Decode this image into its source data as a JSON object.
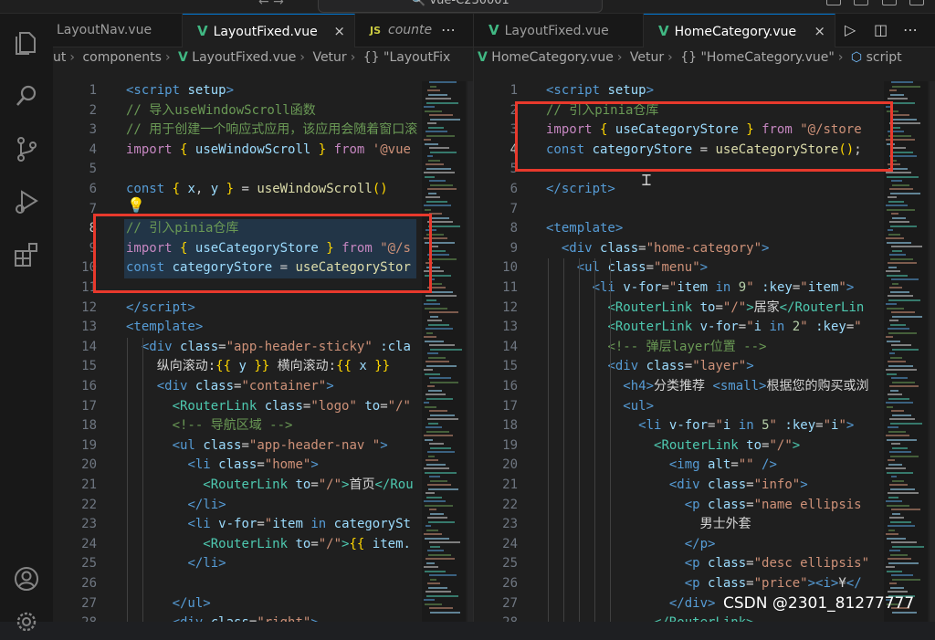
{
  "titlebar": {
    "nav_arrows": "← →",
    "command_center": "🔍 vue-C230001"
  },
  "activity_bar": {
    "icons": [
      "files-icon",
      "search-icon",
      "source-control-icon",
      "run-debug-icon",
      "extensions-icon",
      "account-icon",
      "settings-gear-icon"
    ]
  },
  "left_editor": {
    "tabs": [
      {
        "label": "LayoutNav.vue",
        "type": "vue"
      },
      {
        "label": "LayoutFixed.vue",
        "type": "vue",
        "active": true,
        "close": "×"
      },
      {
        "label": "counte",
        "type": "js"
      }
    ],
    "more": "⋯",
    "breadcrumb": [
      "ut",
      "components",
      "LayoutFixed.vue",
      "Vetur",
      "{} \"LayoutFix"
    ],
    "lines": [
      {
        "n": "1",
        "html": "<span class='tag'>&lt;script</span> <span class='attr'>setup</span><span class='tag'>&gt;</span>"
      },
      {
        "n": "2",
        "html": "<span class='cmt'>// 导入useWindowScroll函数</span>"
      },
      {
        "n": "3",
        "html": "<span class='cmt'>// 用于创建一个响应式应用，该应用会随着窗口滚</span>"
      },
      {
        "n": "4",
        "html": "<span class='kw2'>import</span> <span class='br'>{</span> <span class='var'>useWindowScroll</span> <span class='br'>}</span> <span class='kw2'>from</span> <span class='str'>'@vue</span>"
      },
      {
        "n": "5",
        "html": ""
      },
      {
        "n": "6",
        "html": "<span class='kw'>const</span> <span class='br'>{</span> <span class='var'>x</span>, <span class='var'>y</span> <span class='br'>}</span> = <span class='fn'>useWindowScroll</span><span class='br'>()</span>"
      },
      {
        "n": "7",
        "html": ""
      },
      {
        "n": "8",
        "html": "<span class='cmt'>// 引入pinia仓库</span>",
        "cur": true
      },
      {
        "n": "9",
        "html": "<span class='kw2'>import</span> <span class='br'>{</span> <span class='var'>useCategoryStore</span> <span class='br'>}</span> <span class='kw2'>from</span> <span class='str'>\"@/s</span>"
      },
      {
        "n": "10",
        "html": "<span class='kw'>const</span> <span class='var'>categoryStore</span> = <span class='fn'>useCategoryStor</span>"
      },
      {
        "n": "11",
        "html": ""
      },
      {
        "n": "12",
        "html": "<span class='tag'>&lt;/script&gt;</span>"
      },
      {
        "n": "13",
        "html": "<span class='tag'>&lt;template&gt;</span>"
      },
      {
        "n": "14",
        "html": "  <span class='tag'>&lt;div</span> <span class='attr'>class</span>=<span class='str'>\"app-header-sticky\"</span> <span class='attr'>:cla</span>"
      },
      {
        "n": "15",
        "html": "    <span class='txt'>纵向滚动:</span><span class='br'>{{</span> <span class='var'>y</span> <span class='br'>}}</span> <span class='txt'>横向滚动:</span><span class='br'>{{</span> <span class='var'>x</span> <span class='br'>}}</span>"
      },
      {
        "n": "16",
        "html": "    <span class='tag'>&lt;div</span> <span class='attr'>class</span>=<span class='str'>\"container\"</span><span class='tag'>&gt;</span>"
      },
      {
        "n": "17",
        "html": "      <span class='cmp'>&lt;RouterLink</span> <span class='attr'>class</span>=<span class='str'>\"logo\"</span> <span class='attr'>to</span>=<span class='str'>\"/\"</span>"
      },
      {
        "n": "18",
        "html": "      <span class='cmt'>&lt;!-- 导航区域 --&gt;</span>"
      },
      {
        "n": "19",
        "html": "      <span class='tag'>&lt;ul</span> <span class='attr'>class</span>=<span class='str'>\"app-header-nav \"</span><span class='tag'>&gt;</span>"
      },
      {
        "n": "20",
        "html": "        <span class='tag'>&lt;li</span> <span class='attr'>class</span>=<span class='str'>\"home\"</span><span class='tag'>&gt;</span>"
      },
      {
        "n": "21",
        "html": "          <span class='cmp'>&lt;RouterLink</span> <span class='attr'>to</span>=<span class='str'>\"/\"</span><span class='cmp'>&gt;</span><span class='txt'>首页</span><span class='cmp'>&lt;/Rou</span>"
      },
      {
        "n": "22",
        "html": "        <span class='tag'>&lt;/li&gt;</span>"
      },
      {
        "n": "23",
        "html": "        <span class='tag'>&lt;li</span> <span class='attr'>v-for</span>=<span class='str'>\"</span><span class='var'>item</span> <span class='kw'>in</span> <span class='var'>categorySt</span>"
      },
      {
        "n": "24",
        "html": "          <span class='cmp'>&lt;RouterLink</span> <span class='attr'>to</span>=<span class='str'>\"/\"</span><span class='cmp'>&gt;</span><span class='br'>{{</span> <span class='var'>item.</span>"
      },
      {
        "n": "25",
        "html": "        <span class='tag'>&lt;/li&gt;</span>"
      },
      {
        "n": "26",
        "html": ""
      },
      {
        "n": "27",
        "html": "      <span class='tag'>&lt;/ul&gt;</span>"
      },
      {
        "n": "28",
        "html": "      <span class='tag'>&lt;div</span> <span class='attr'>class</span>=<span class='str'>\"right\"</span><span class='tag'>&gt;</span>"
      }
    ]
  },
  "right_editor": {
    "tabs": [
      {
        "label": "LayoutFixed.vue",
        "type": "vue"
      },
      {
        "label": "HomeCategory.vue",
        "type": "vue",
        "active": true,
        "close": "×"
      }
    ],
    "run_icon": "▷",
    "split_icon": "◫",
    "more": "⋯",
    "breadcrumb": [
      "HomeCategory.vue",
      "Vetur",
      "{} \"HomeCategory.vue\"",
      "script"
    ],
    "lines": [
      {
        "n": "1",
        "html": "<span class='tag'>&lt;script</span> <span class='attr'>setup</span><span class='tag'>&gt;</span>"
      },
      {
        "n": "2",
        "html": "<span class='cmt'>// 引入pinia仓库</span>"
      },
      {
        "n": "3",
        "html": "<span class='kw2'>import</span> <span class='br'>{</span> <span class='var'>useCategoryStore</span> <span class='br'>}</span> <span class='kw2'>from</span> <span class='str'>\"@/store</span>"
      },
      {
        "n": "4",
        "html": "<span class='kw'>const</span> <span class='var'>categoryStore</span> = <span class='fn'>useCategoryStore</span><span class='br'>()</span>;",
        "cur": true
      },
      {
        "n": "5",
        "html": ""
      },
      {
        "n": "6",
        "html": "<span class='tag'>&lt;/script&gt;</span>"
      },
      {
        "n": "7",
        "html": ""
      },
      {
        "n": "8",
        "html": "<span class='tag'>&lt;template&gt;</span>"
      },
      {
        "n": "9",
        "html": "  <span class='tag'>&lt;div</span> <span class='attr'>class</span>=<span class='str'>\"home-category\"</span><span class='tag'>&gt;</span>"
      },
      {
        "n": "10",
        "html": "    <span class='tag'>&lt;ul</span> <span class='attr'>class</span>=<span class='str'>\"menu\"</span><span class='tag'>&gt;</span>"
      },
      {
        "n": "11",
        "html": "      <span class='tag'>&lt;li</span> <span class='attr'>v-for</span>=<span class='str'>\"</span><span class='var'>item</span> <span class='kw'>in</span> <span class='num'>9</span><span class='str'>\"</span> <span class='attr'>:key</span>=<span class='str'>\"</span><span class='var'>item</span><span class='str'>\"</span><span class='tag'>&gt;</span>"
      },
      {
        "n": "12",
        "html": "        <span class='cmp'>&lt;RouterLink</span> <span class='attr'>to</span>=<span class='str'>\"/\"</span><span class='cmp'>&gt;</span><span class='txt'>居家</span><span class='cmp'>&lt;/RouterLin</span>"
      },
      {
        "n": "13",
        "html": "        <span class='cmp'>&lt;RouterLink</span> <span class='attr'>v-for</span>=<span class='str'>\"</span><span class='var'>i</span> <span class='kw'>in</span> <span class='num'>2</span><span class='str'>\"</span> <span class='attr'>:key</span>=<span class='str'>\"</span>"
      },
      {
        "n": "14",
        "html": "        <span class='cmt'>&lt;!-- 弹层layer位置 --&gt;</span>"
      },
      {
        "n": "15",
        "html": "        <span class='tag'>&lt;div</span> <span class='attr'>class</span>=<span class='str'>\"layer\"</span><span class='tag'>&gt;</span>"
      },
      {
        "n": "16",
        "html": "          <span class='tag'>&lt;h4&gt;</span><span class='txt'>分类推荐 </span><span class='tag'>&lt;small&gt;</span><span class='txt'>根据您的购买或浏</span>"
      },
      {
        "n": "17",
        "html": "          <span class='tag'>&lt;ul&gt;</span>"
      },
      {
        "n": "18",
        "html": "            <span class='tag'>&lt;li</span> <span class='attr'>v-for</span>=<span class='str'>\"</span><span class='var'>i</span> <span class='kw'>in</span> <span class='num'>5</span><span class='str'>\"</span> <span class='attr'>:key</span>=<span class='str'>\"</span><span class='var'>i</span><span class='str'>\"</span><span class='tag'>&gt;</span>"
      },
      {
        "n": "19",
        "html": "              <span class='cmp'>&lt;RouterLink</span> <span class='attr'>to</span>=<span class='str'>\"/\"</span><span class='cmp'>&gt;</span>"
      },
      {
        "n": "20",
        "html": "                <span class='tag'>&lt;img</span> <span class='attr'>alt</span>=<span class='str'>\"\"</span> <span class='tag'>/&gt;</span>"
      },
      {
        "n": "21",
        "html": "                <span class='tag'>&lt;div</span> <span class='attr'>class</span>=<span class='str'>\"info\"</span><span class='tag'>&gt;</span>"
      },
      {
        "n": "22",
        "html": "                  <span class='tag'>&lt;p</span> <span class='attr'>class</span>=<span class='str'>\"name ellipsis</span>"
      },
      {
        "n": "23",
        "html": "                    <span class='txt'>男士外套</span>"
      },
      {
        "n": "24",
        "html": "                  <span class='tag'>&lt;/p&gt;</span>"
      },
      {
        "n": "25",
        "html": "                  <span class='tag'>&lt;p</span> <span class='attr'>class</span>=<span class='str'>\"desc ellipsis\"</span>"
      },
      {
        "n": "26",
        "html": "                  <span class='tag'>&lt;p</span> <span class='attr'>class</span>=<span class='str'>\"price\"</span><span class='tag'>&gt;&lt;i&gt;</span><span class='txt'>¥</span><span class='tag'>&lt;/</span>"
      },
      {
        "n": "27",
        "html": "                <span class='tag'>&lt;/div&gt;</span>"
      },
      {
        "n": "28",
        "html": "              <span class='cmp'>&lt;/RouterLink&gt;</span>"
      }
    ]
  },
  "watermark": "CSDN @2301_81277777",
  "colors": {
    "highlight_box": "#e8392c",
    "accent_tab": "#0078d4",
    "vue_green": "#41b883"
  }
}
